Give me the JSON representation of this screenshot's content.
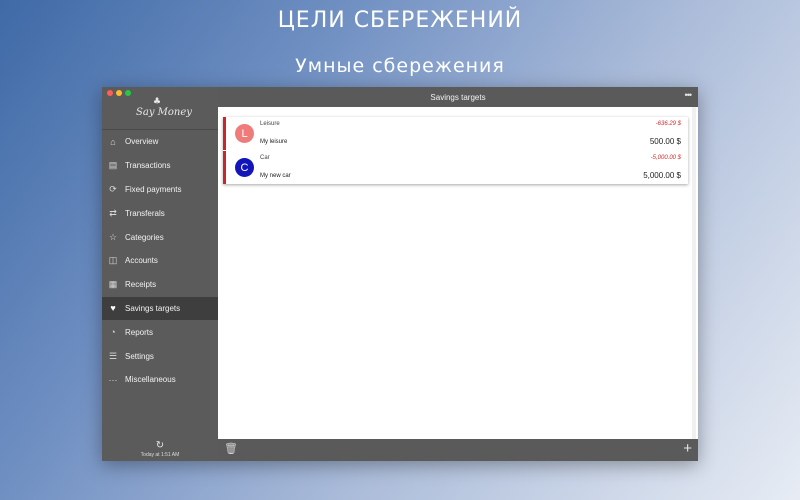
{
  "promo": {
    "headline": "ЦЕЛИ СБЕРЕЖЕНИЙ",
    "subheadline": "Умные сбережения"
  },
  "app": {
    "logo_text": "Say Money",
    "window_title": "Savings targets"
  },
  "sidebar": {
    "items": [
      {
        "label": "Overview",
        "icon": "home-icon"
      },
      {
        "label": "Transactions",
        "icon": "list-icon"
      },
      {
        "label": "Fixed payments",
        "icon": "cycle-icon"
      },
      {
        "label": "Transferals",
        "icon": "shuffle-icon"
      },
      {
        "label": "Categories",
        "icon": "star-icon"
      },
      {
        "label": "Accounts",
        "icon": "book-icon"
      },
      {
        "label": "Receipts",
        "icon": "receipt-icon"
      },
      {
        "label": "Savings targets",
        "icon": "heart-icon",
        "active": true
      },
      {
        "label": "Reports",
        "icon": "gauge-icon"
      },
      {
        "label": "Settings",
        "icon": "sliders-icon"
      },
      {
        "label": "Miscellaneous",
        "icon": "ellipsis-icon"
      }
    ],
    "sync_status": "Today at 1:51 AM"
  },
  "targets": [
    {
      "initial": "L",
      "category": "Leisure",
      "name": "My leisure",
      "remaining": "-636.29 $",
      "amount": "500.00 $",
      "color": "#f07b7b"
    },
    {
      "initial": "C",
      "category": "Car",
      "name": "My new car",
      "remaining": "-5,000.00 $",
      "amount": "5,000.00 $",
      "color": "#1216b8"
    }
  ],
  "colors": {
    "accent_red": "#c8252c",
    "sidebar_bg": "#5b5b5b",
    "active_item_bg": "#3e3e3e"
  }
}
